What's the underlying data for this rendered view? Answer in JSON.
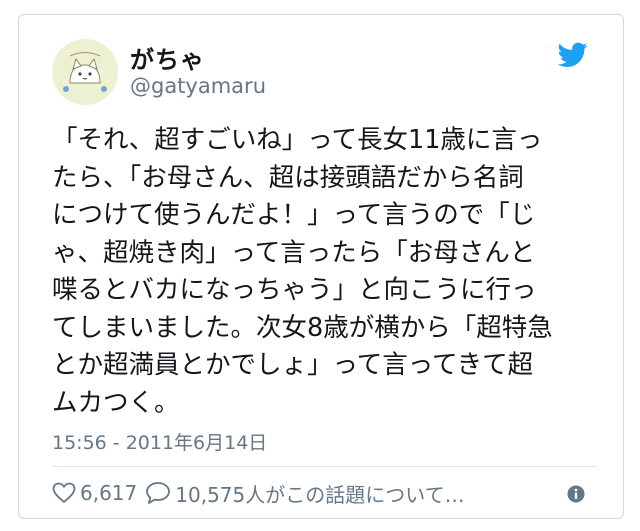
{
  "author": {
    "display_name": "がちゃ",
    "handle": "@gatyamaru"
  },
  "tweet": {
    "lines": [
      "「それ、超すごいね」って長女11歳に言っ",
      "たら、「お母さん、超は接頭語だから名詞",
      "につけて使うんだよ！」って言うので「じ",
      "ゃ、超焼き肉」って言ったら「お母さんと",
      "喋るとバカになっちゃう」と向こうに行っ",
      "てしまいました。次女8歳が横から「超特急",
      "とか超満員とかでしょ」って言ってきて超",
      "ムカつく。"
    ],
    "timestamp": "15:56 - 2011年6月14日"
  },
  "actions": {
    "likes": "6,617",
    "replies_text": "10,575人がこの話題について…"
  },
  "icons": {
    "like": "heart-icon",
    "reply": "speech-bubble-icon",
    "info": "info-icon",
    "brand": "twitter-bird-icon"
  },
  "colors": {
    "brand_blue": "#1da1f2",
    "text": "#14171a",
    "muted": "#657786"
  }
}
